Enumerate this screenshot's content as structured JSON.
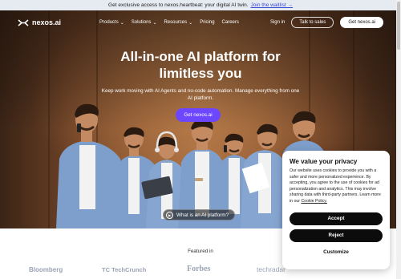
{
  "announcement": {
    "text": "Get exclusive access to nexos.heartbeat: your digital AI twin.",
    "link": "Join the waitlist →"
  },
  "nav": {
    "logo_text": "nexos.ai",
    "menu": [
      {
        "label": "Products",
        "dropdown": true
      },
      {
        "label": "Solutions",
        "dropdown": true
      },
      {
        "label": "Resources",
        "dropdown": true
      },
      {
        "label": "Pricing",
        "dropdown": false
      },
      {
        "label": "Careers",
        "dropdown": false
      }
    ],
    "signin": "Sign in",
    "talk_to_sales": "Talk to sales",
    "get_started": "Get nexos.ai"
  },
  "hero": {
    "title_line1": "All-in-one AI platform for",
    "title_line2": "limitless you",
    "subtitle_line1": "Keep work moving with AI Agents and no-code automation. Manage everything from one",
    "subtitle_line2": "AI platform.",
    "cta": "Get nexos.ai",
    "video_button": "What is an AI platform?"
  },
  "featured": {
    "label": "Featured in",
    "brands": [
      "Bloomberg",
      "TechCrunch",
      "Forbes",
      "techradar"
    ]
  },
  "cookie": {
    "title": "We value your privacy",
    "body": "Our website uses cookies to provide you with a safer and more personalized experience. By accepting, you agree to the use of cookies for ad personalization and analytics. This may involve sharing data with third-party partners. Learn more in our",
    "policy_link": "Cookie Policy.",
    "accept": "Accept",
    "reject": "Reject",
    "customize": "Customize"
  },
  "colors": {
    "accent": "#6c47ff",
    "announcement_bg": "#e6ebf2",
    "dark_button": "#0c0c0c",
    "shirt_blue": "#7e9fcc"
  }
}
